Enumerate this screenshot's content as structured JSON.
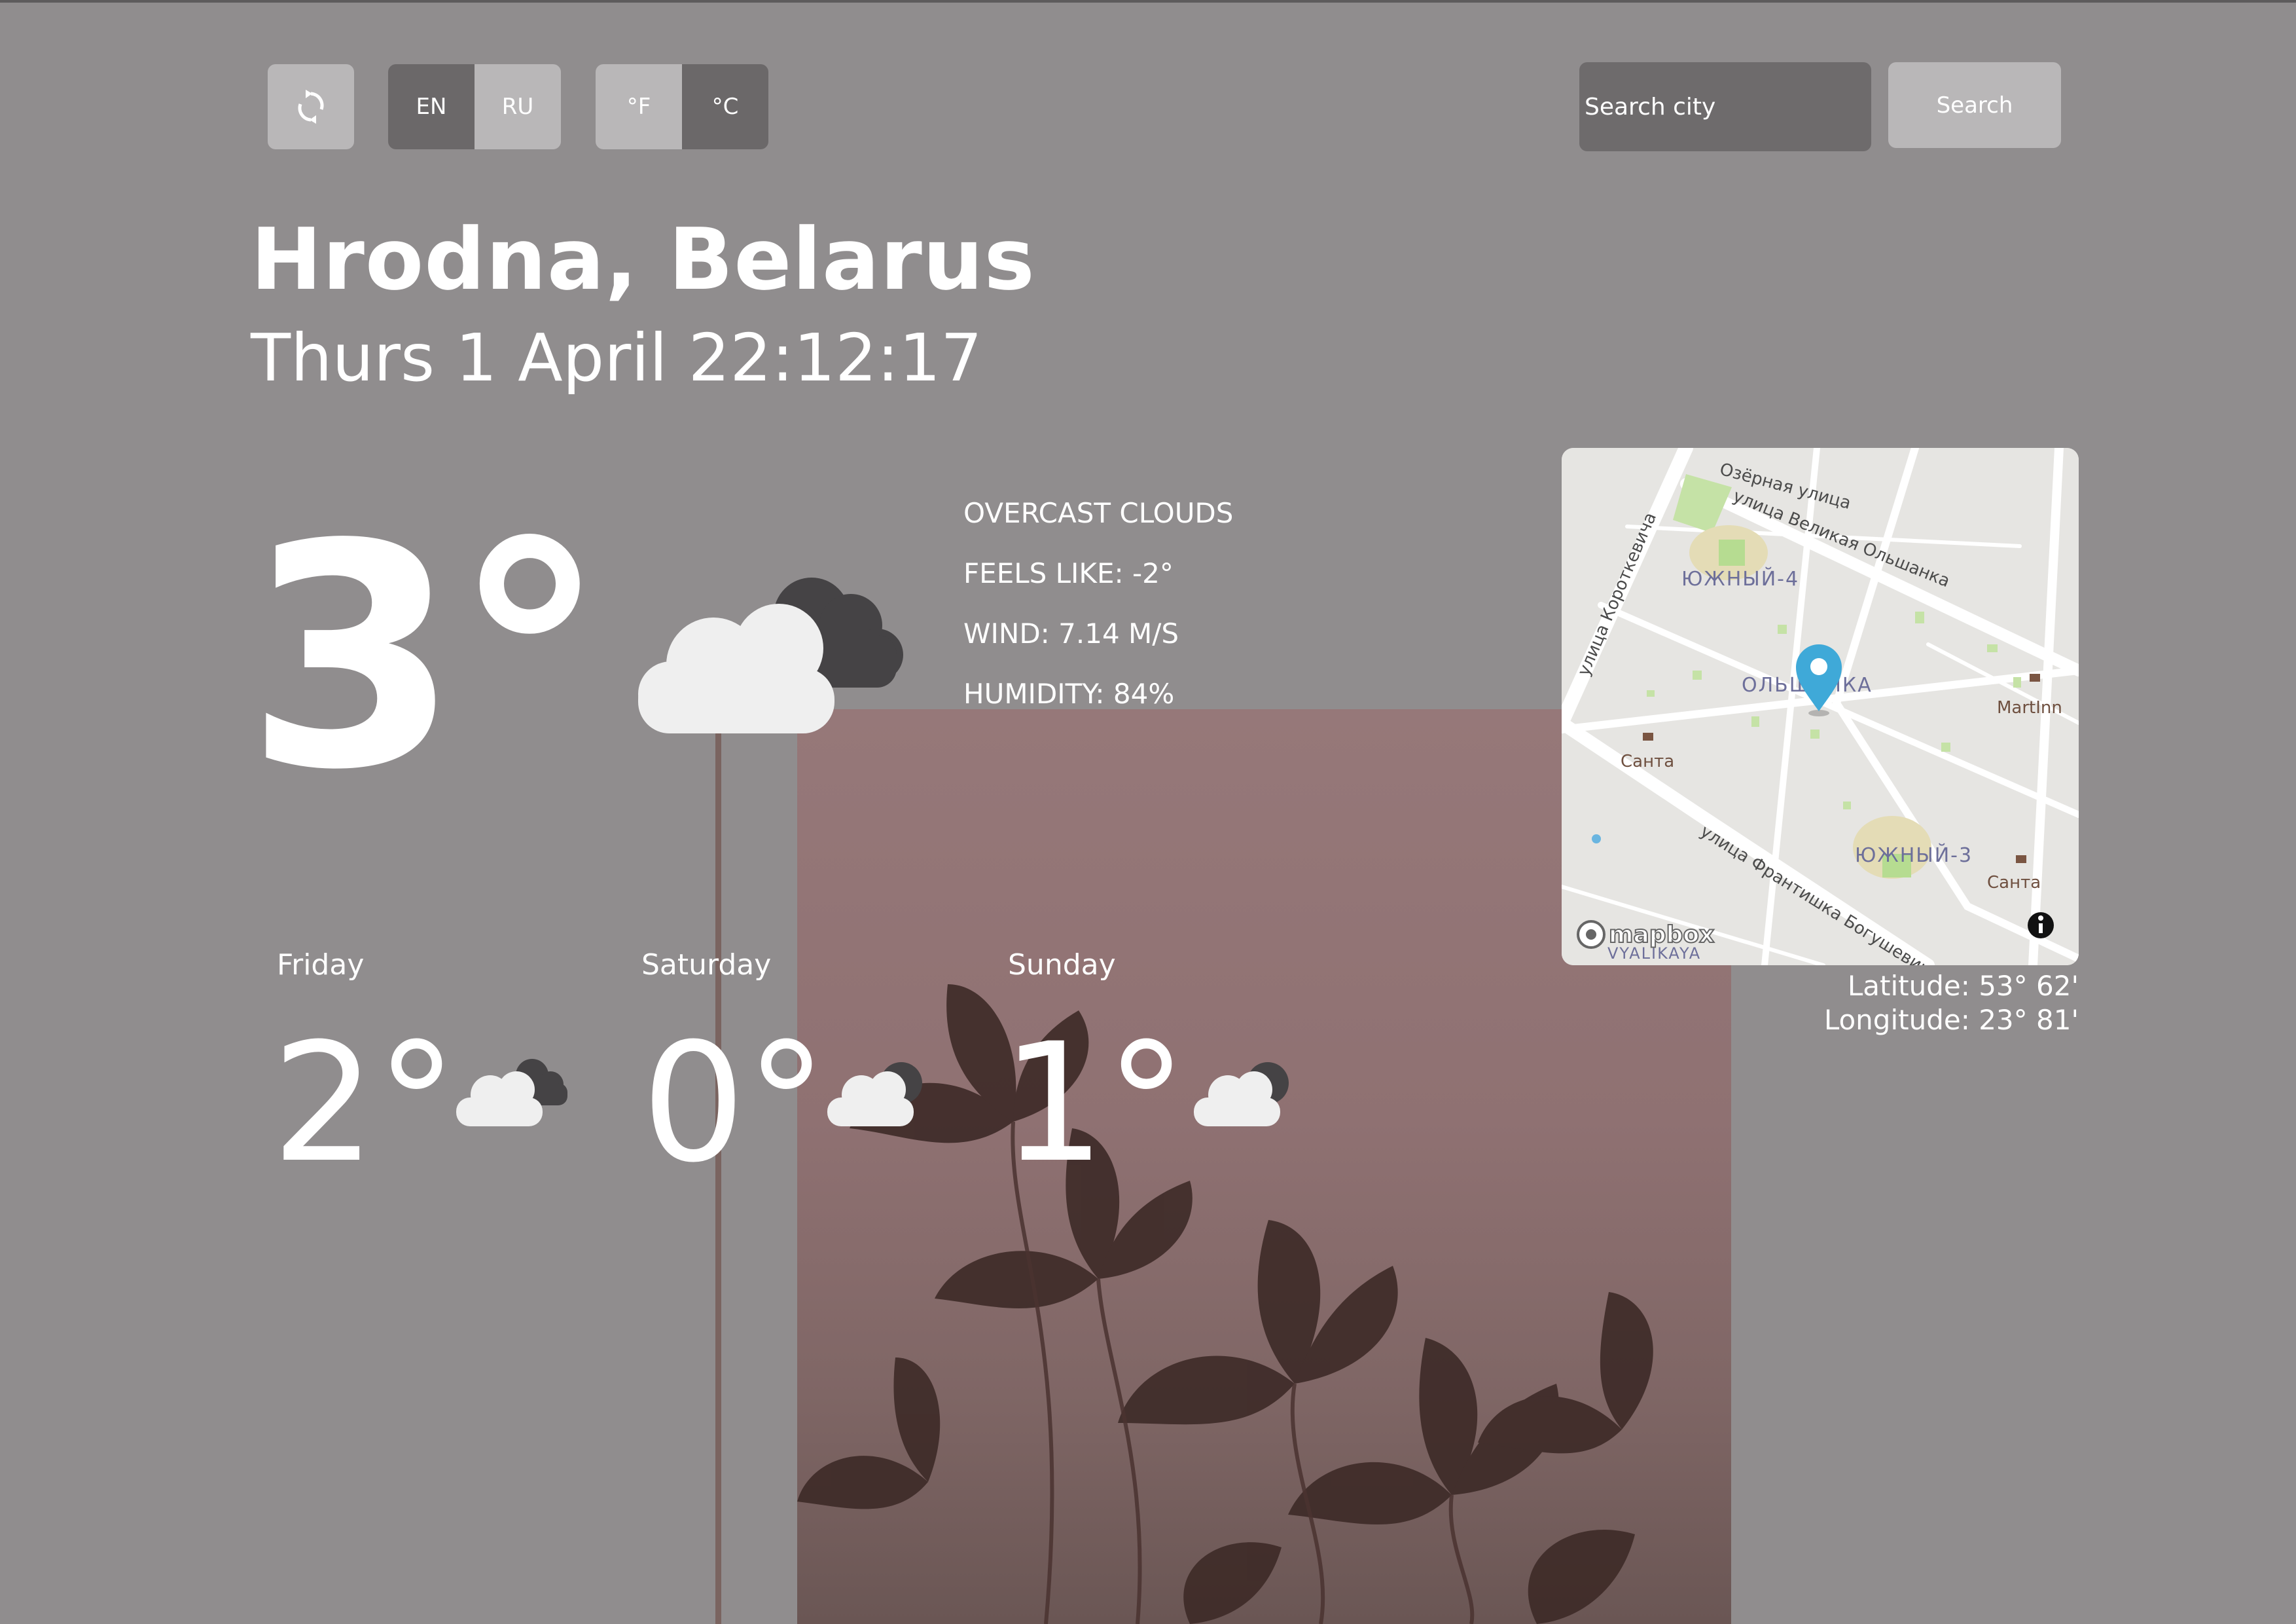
{
  "controls": {
    "refresh_icon": "refresh-icon",
    "languages": [
      "EN",
      "RU"
    ],
    "active_language": "EN",
    "units": [
      "°F",
      "°C"
    ],
    "active_unit": "°C",
    "search_placeholder": "Search city",
    "search_button": "Search"
  },
  "location": {
    "city": "Hrodna, Belarus",
    "datetime": "Thurs 1 April 22:12:17"
  },
  "current": {
    "temperature": "3°",
    "icon": "overcast-clouds-icon",
    "condition": "OVERCAST CLOUDS",
    "feels_like": "FEELS LIKE: -2°",
    "wind": "WIND: 7.14 M/S",
    "humidity": "HUMIDITY: 84%"
  },
  "map": {
    "labels": {
      "street1": "Озёрная улица",
      "street2": "улица Великая Ольшанка",
      "street3": "улица Короткевича",
      "district1": "ЮЖНЫЙ-4",
      "district2": "ОЛЬШАНКА",
      "district3": "ЮЖНЫЙ-3",
      "shop1": "MartInn",
      "shop2": "Санта",
      "shop3": "Санта",
      "street4": "улица Франтишка Богушевича",
      "area_bottom": "VYALIKAYA",
      "attribution": "mapbox"
    },
    "latitude": "Latitude: 53° 62'",
    "longitude": "Longitude: 23° 81'"
  },
  "forecast": [
    {
      "day": "Friday",
      "temp": "2°",
      "icon": "overcast-clouds-icon"
    },
    {
      "day": "Saturday",
      "temp": "0°",
      "icon": "broken-clouds-icon"
    },
    {
      "day": "Sunday",
      "temp": "1°",
      "icon": "broken-clouds-icon"
    }
  ]
}
